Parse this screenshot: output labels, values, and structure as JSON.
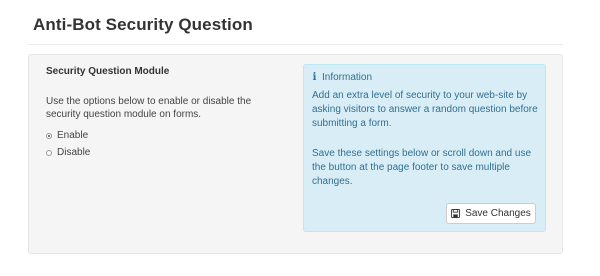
{
  "page": {
    "title": "Anti-Bot Security Question"
  },
  "module": {
    "title": "Security Question Module",
    "description": "Use the options below to enable or disable the security question module on forms.",
    "options": [
      {
        "label": "Enable",
        "selected": true
      },
      {
        "label": "Disable",
        "selected": false
      }
    ]
  },
  "info": {
    "heading": "Information",
    "icon": "info-icon",
    "paragraph1": "Add an extra level of security to your web-site by asking visitors to answer a random question before submitting a form.",
    "paragraph2": "Save these settings below or scroll down and use the button at the page footer to save multiple changes.",
    "colors": {
      "background": "#d9edf7",
      "border": "#bce8f1",
      "text": "#31708f"
    }
  },
  "actions": {
    "save_label": "Save Changes",
    "save_icon": "floppy-disk-icon"
  }
}
